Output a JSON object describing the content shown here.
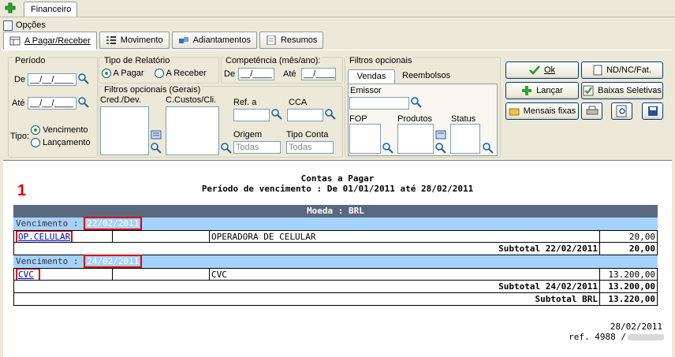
{
  "top": {
    "tab": "Financeiro",
    "opcoes": "Opções"
  },
  "tabs": [
    {
      "label": "A Pagar/Receber",
      "icon": "document-table-icon"
    },
    {
      "label": "Movimento",
      "icon": "list-icon"
    },
    {
      "label": "Adiantamentos",
      "icon": "cubes-icon"
    },
    {
      "label": "Resumos",
      "icon": "document-icon"
    }
  ],
  "periodo": {
    "title": "Período",
    "de": "De",
    "ate": "Até",
    "date_value": "__/__/____",
    "tipo": "Tipo:",
    "opt1": "Vencimento",
    "opt2": "Lançamento"
  },
  "tipo_rel": {
    "title": "Tipo de Relatório",
    "opt1": "A Pagar",
    "opt2": "A Receber"
  },
  "competencia": {
    "title": "Competência (mês/ano):",
    "de": "De",
    "ate": "Até",
    "value": "__/____"
  },
  "gerais": {
    "title": "Filtros opcionais (Gerais)",
    "cred": "Cred./Dev.",
    "ccustos": "C.Custos/Cli.",
    "ref": "Ref. a",
    "cca": "CCA",
    "origem": "Origem",
    "tipo_conta": "Tipo Conta",
    "todas": "Todas"
  },
  "opcionais": {
    "title": "Filtros opcionais",
    "tab1": "Vendas",
    "tab2": "Reembolsos",
    "emissor": "Emissor",
    "fop": "FOP",
    "produtos": "Produtos",
    "status": "Status"
  },
  "buttons": {
    "ok": "Ok",
    "nd": "ND/NC/Fat.",
    "lancar": "Lançar",
    "baixas": "Baixas Seletivas",
    "mensais": "Mensais fixas"
  },
  "report": {
    "title": "Contas a Pagar",
    "subtitle": "Período de vencimento : De 01/01/2011 até 28/02/2011",
    "marker": "1",
    "moeda": "Moeda : BRL",
    "venc_label": "Vencimento :",
    "groups": [
      {
        "date": "22/02/2011",
        "code": "OP.CELULAR",
        "desc": "OPERADORA DE CELULAR",
        "value": "20,00",
        "subtotal_label": "Subtotal 22/02/2011",
        "subtotal": "20,00"
      },
      {
        "date": "24/02/2011",
        "code": "CVC",
        "desc": "CVC",
        "value": "13.200,00",
        "subtotal_label": "Subtotal 24/02/2011",
        "subtotal": "13.200,00"
      }
    ],
    "total_label": "Subtotal BRL",
    "total": "13.220,00",
    "footer_date": "28/02/2011",
    "footer_ref": "ref. 4988 /"
  },
  "colors": {
    "accent_red": "#e00000",
    "header_bar": "#5a6980",
    "venc_bar": "#a6d2ff"
  }
}
